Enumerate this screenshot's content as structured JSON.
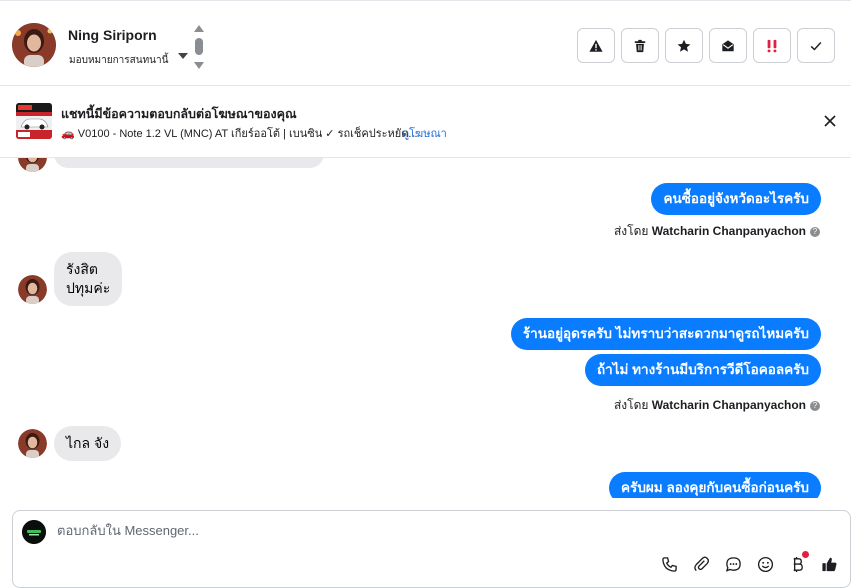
{
  "header": {
    "contact_name": "Ning Siriporn",
    "assign_label": "มอบหมายการสนทนานี้",
    "actions": [
      "warning-icon",
      "trash-icon",
      "star-icon",
      "mark-unread-icon",
      "priority-icon",
      "check-icon"
    ],
    "priority_color": "#e41e3f"
  },
  "ad_banner": {
    "title": "แชทนี้มีข้อความตอบกลับต่อโฆษณาของคุณ",
    "description": "🚗 V0100 - Note 1.2 VL (MNC) AT เกียร์ออโต้ | เบนซิน ✓ รถเช็คประหยัด...",
    "link": "ดูโฆษณา"
  },
  "messages": [
    {
      "dir": "out",
      "text": "คนซื้ออยู่จังหวัดอะไรครับ"
    },
    {
      "dir": "sender",
      "prefix": "ส่งโดย",
      "name": "Watcharin Chanpanyachon"
    },
    {
      "dir": "in",
      "line1": "รังสิต",
      "line2": "ปทุมค่ะ"
    },
    {
      "dir": "out",
      "text": "ร้านอยู่อุดรครับ ไม่ทราบว่าสะดวกมาดูรถไหมครับ"
    },
    {
      "dir": "out",
      "text": "ถ้าไม่ ทางร้านมีบริการวีดีโอคอลครับ"
    },
    {
      "dir": "sender",
      "prefix": "ส่งโดย",
      "name": "Watcharin Chanpanyachon"
    },
    {
      "dir": "in",
      "text": "ไกล จัง"
    },
    {
      "dir": "out",
      "text": "ครับผม ลองคุยกับคนซื้อก่อนครับ"
    }
  ],
  "composer": {
    "placeholder": "ตอบกลับใน Messenger...",
    "tools": [
      "phone-icon",
      "attachment-icon",
      "saved-reply-icon",
      "emoji-icon",
      "baht-payment-icon",
      "thumbs-up-icon"
    ]
  },
  "colors": {
    "outgoing_bubble": "#0a7cff",
    "incoming_bubble": "#e9e9eb",
    "link": "#216fdb"
  }
}
